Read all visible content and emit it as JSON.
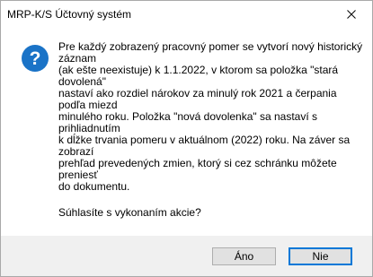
{
  "window": {
    "title": "MRP-K/S Účtovný systém",
    "close_icon": "close-icon"
  },
  "dialog": {
    "icon": "question-icon",
    "icon_color": "#1a73c7",
    "message_lines": [
      "Pre každý zobrazený pracovný pomer se vytvorí nový historický",
      "záznam",
      "(ak ešte neexistuje) k 1.1.2022, v ktorom sa položka \"stará",
      "dovolená\"",
      "nastaví ako rozdiel nárokov za minulý rok 2021 a čerpania",
      "podľa miezd",
      "minulého roku. Položka \"nová dovolenka\" sa nastaví s",
      "prihliadnutím",
      "k dĺžke trvania pomeru v aktuálnom (2022) roku. Na záver sa",
      "zobrazí",
      "prehľad prevedených zmien, ktorý si cez schránku môžete",
      "preniesť",
      "do dokumentu."
    ],
    "question": "Súhlasíte s vykonaním akcie?"
  },
  "buttons": {
    "yes_label": "Áno",
    "no_label": "Nie",
    "default_border_color": "#0078d7"
  }
}
